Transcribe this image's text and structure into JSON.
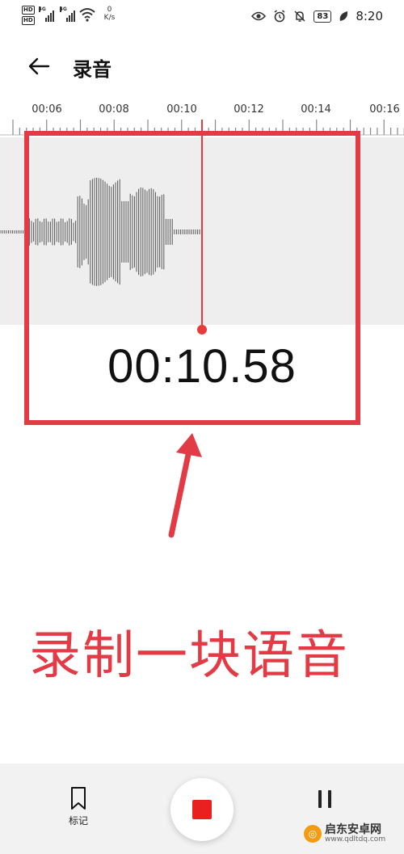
{
  "status_bar": {
    "hd1": "HD",
    "hd2": "HD",
    "net1": "4G",
    "net2": "4G",
    "speed_value": "0",
    "speed_unit": "K/s",
    "battery": "83",
    "time": "8:20"
  },
  "header": {
    "title": "录音"
  },
  "ruler": {
    "labels": [
      "00:06",
      "00:08",
      "00:10",
      "00:12",
      "00:14",
      "00:16"
    ]
  },
  "recorder": {
    "timer": "00:10.58"
  },
  "annotation": {
    "text": "录制一块语音"
  },
  "bottom_bar": {
    "mark_label": "标记"
  },
  "watermark": {
    "name": "启东安卓网",
    "url": "www.qdltdq.com"
  },
  "colors": {
    "accent_red": "#e23b45",
    "stop_red": "#e82020",
    "wave_bg": "#eeeeee"
  }
}
